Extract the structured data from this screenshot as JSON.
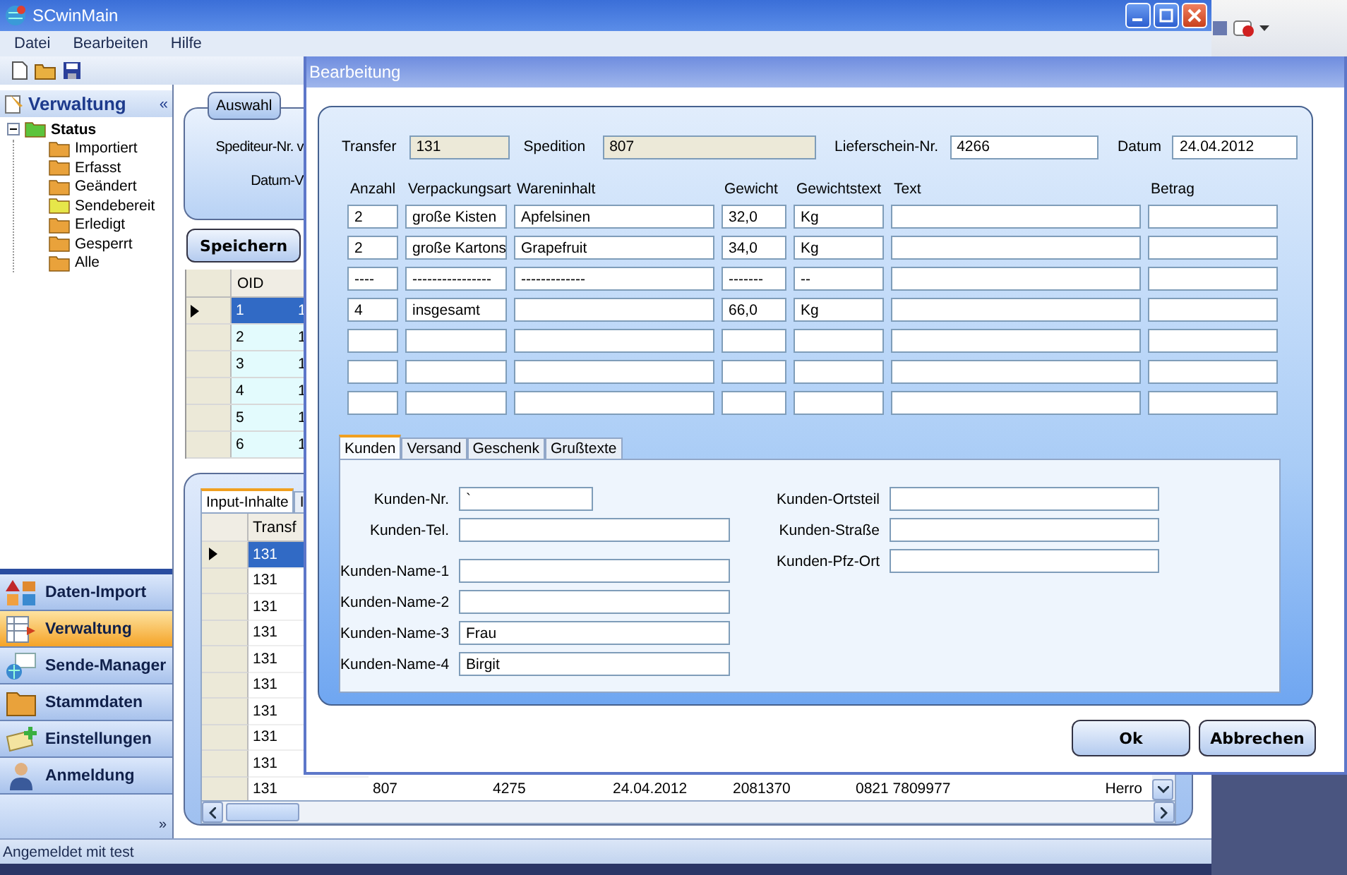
{
  "main_window": {
    "title": "SCwinMain"
  },
  "menu": [
    "Datei",
    "Bearbeiten",
    "Hilfe"
  ],
  "sidebar": {
    "title": "Verwaltung",
    "collapse": "«",
    "tree": [
      {
        "label": "Status",
        "color": "#5cc43c",
        "expanded": true,
        "children": [
          {
            "label": "Importiert",
            "color": "#e9a23b"
          },
          {
            "label": "Erfasst",
            "color": "#e9a23b"
          },
          {
            "label": "Geändert",
            "color": "#e9a23b"
          },
          {
            "label": "Sendebereit",
            "color": "#e6e64a"
          },
          {
            "label": "Erledigt",
            "color": "#e9a23b"
          },
          {
            "label": "Gesperrt",
            "color": "#e9a23b"
          },
          {
            "label": "Alle",
            "color": "#e9a23b"
          }
        ]
      }
    ],
    "nav": [
      {
        "label": "Daten-Import",
        "kind": "import",
        "selected": false
      },
      {
        "label": "Verwaltung",
        "kind": "admin",
        "selected": true
      },
      {
        "label": "Sende-Manager",
        "kind": "send",
        "selected": false
      },
      {
        "label": "Stammdaten",
        "kind": "folder",
        "selected": false
      },
      {
        "label": "Einstellungen",
        "kind": "settings",
        "selected": false
      },
      {
        "label": "Anmeldung",
        "kind": "login",
        "selected": false
      }
    ],
    "more": "»"
  },
  "selection": {
    "tab": "Auswahl",
    "labels": [
      "Spediteur-Nr. v",
      "Datum-V"
    ],
    "save_button": "Speichern"
  },
  "top_grid": {
    "columns": [
      "OID"
    ],
    "rows": [
      {
        "cells": [
          "1",
          "1"
        ],
        "selected": true
      },
      {
        "cells": [
          "2",
          "1"
        ],
        "selected": false
      },
      {
        "cells": [
          "3",
          "1"
        ],
        "selected": false
      },
      {
        "cells": [
          "4",
          "1"
        ],
        "selected": false
      },
      {
        "cells": [
          "5",
          "1"
        ],
        "selected": false
      },
      {
        "cells": [
          "6",
          "1"
        ],
        "selected": false
      }
    ]
  },
  "bottom_panel": {
    "tabs": [
      {
        "label": "Input-Inhalte",
        "selected": true
      },
      {
        "label": "I",
        "selected": false
      }
    ],
    "grid": {
      "columns": [
        "Transf"
      ],
      "rows": [
        {
          "cells": [
            "131"
          ],
          "selected": true
        },
        {
          "cells": [
            "131"
          ],
          "selected": false
        },
        {
          "cells": [
            "131"
          ],
          "selected": false
        },
        {
          "cells": [
            "131"
          ],
          "selected": false
        },
        {
          "cells": [
            "131"
          ],
          "selected": false
        },
        {
          "cells": [
            "131"
          ],
          "selected": false
        },
        {
          "cells": [
            "131"
          ],
          "selected": false
        },
        {
          "cells": [
            "131"
          ],
          "selected": false
        },
        {
          "cells": [
            "131"
          ],
          "selected": false
        },
        {
          "cells": [
            "131",
            "807",
            "4275",
            "24.04.2012",
            "2081370",
            "0821 7809977",
            "Herro"
          ],
          "selected": false
        }
      ]
    }
  },
  "status_bar": "Angemeldet mit test",
  "dialog": {
    "title": "Bearbeitung",
    "header_fields": [
      {
        "label": "Transfer",
        "value": "131",
        "readonly": true
      },
      {
        "label": "Spedition",
        "value": "807",
        "readonly": true
      },
      {
        "label": "Lieferschein-Nr.",
        "value": "4266",
        "readonly": false
      },
      {
        "label": "Datum",
        "value": "24.04.2012",
        "readonly": false
      }
    ],
    "items": {
      "columns": [
        "Anzahl",
        "Verpackungsart",
        "Wareninhalt",
        "Gewicht",
        "Gewichtstext",
        "Text",
        "Betrag"
      ],
      "rows": [
        [
          "2",
          "große Kisten",
          "Apfelsinen",
          "32,0",
          "Kg"
        ],
        [
          "2",
          "große Kartons",
          "Grapefruit",
          "34,0",
          "Kg"
        ],
        [
          "----",
          "----------------",
          "-------------",
          "-------",
          "--"
        ],
        [
          "4",
          "insgesamt",
          null,
          "66,0",
          "Kg"
        ]
      ]
    },
    "tabs": [
      {
        "label": "Kunden",
        "selected": true
      },
      {
        "label": "Versand",
        "selected": false
      },
      {
        "label": "Geschenk",
        "selected": false
      },
      {
        "label": "Grußtexte",
        "selected": false
      }
    ],
    "customer_left": [
      [
        {
          "label": "Kunden-Nr.",
          "value": "`",
          "kind": "short"
        },
        {
          "label": "Kunden-Tel.",
          "kind": "long"
        }
      ],
      [
        {
          "label": "Kunden-Name-1",
          "kind": "long"
        },
        {
          "label": "Kunden-Name-2",
          "kind": "long"
        },
        {
          "label": "Kunden-Name-3",
          "value": "Frau",
          "kind": "long"
        },
        {
          "label": "Kunden-Name-4",
          "value": "Birgit",
          "kind": "long"
        }
      ]
    ],
    "customer_right": [
      {
        "label": "Kunden-Ortsteil"
      },
      {
        "label": "Kunden-Straße"
      },
      {
        "label": "Kunden-Pfz-Ort"
      }
    ],
    "buttons": [
      "Ok",
      "Abbrechen"
    ]
  }
}
